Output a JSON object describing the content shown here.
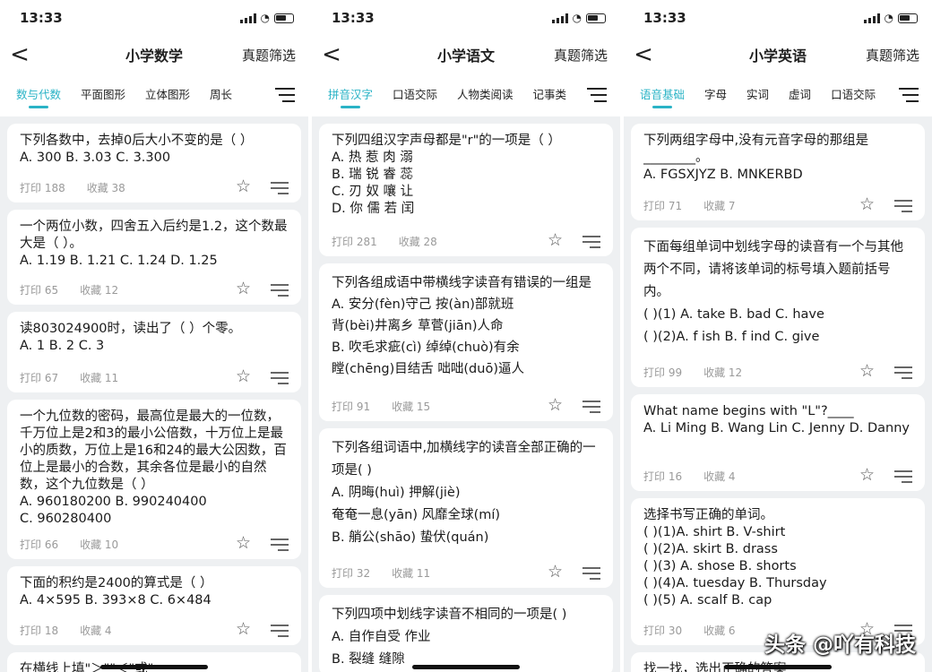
{
  "screens": [
    {
      "time": "13:33",
      "title": "小学数学",
      "filter": "真题筛选",
      "tabs": [
        "数与代数",
        "平面图形",
        "立体图形",
        "周长"
      ],
      "cards": [
        {
          "text": "下列各数中，去掉0后大小不变的是（  ）\nA.  300    B.  3.03    C.  3.300",
          "print": "打印 188",
          "fav": "收藏 38"
        },
        {
          "text": "一个两位小数，四舍五入后约是1.2，这个数最大是（  ）。\nA.  1.19    B.  1.21    C.  1.24    D.  1.25",
          "print": "打印 65",
          "fav": "收藏 12"
        },
        {
          "text": "读803024900时，读出了（  ）个零。\nA.  1    B.  2    C.  3",
          "print": "打印 67",
          "fav": "收藏 11"
        },
        {
          "text": "一个九位数的密码，最高位是最大的一位数，千万位上是2和3的最小公倍数，十万位上是最小的质数，万位上是16和24的最大公因数，百位上是最小的合数，其余各位是最小的自然数，这个九位数是（  ）\nA.   960180200       B.   990240400\nC.   960280400",
          "print": "打印 66",
          "fav": "收藏 10"
        },
        {
          "text": "下面的积约是2400的算式是（  ）\nA.  4×595    B.  393×8    C.  6×484",
          "print": "打印 18",
          "fav": "收藏 4"
        },
        {
          "text": "在横线上填\"＞\"\"＜\"或\"",
          "print": "",
          "fav": ""
        }
      ]
    },
    {
      "time": "13:33",
      "title": "小学语文",
      "filter": "真题筛选",
      "tabs": [
        "拼音汉字",
        "口语交际",
        "人物类阅读",
        "记事类"
      ],
      "cards": [
        {
          "text": "下列四组汉字声母都是\"r\"的一项是（  ）\nA. 热  惹  肉  溺\nB. 瑞  锐  睿  蕊\nC. 刃  奴  嚷  让\nD. 你  儒  若  闰",
          "print": "打印 281",
          "fav": "收藏 28"
        },
        {
          "text": "下列各组成语中带横线字读音有错误的一组是\nA. 安分(fèn)守己      按(àn)部就班\n     背(bèi)井离乡      草菅(jiān)人命\nB. 吹毛求疵(cì)        绰绰(chuò)有余\n     瞠(chēng)目结舌    咄咄(duō)逼人",
          "print": "打印 91",
          "fav": "收藏 15"
        },
        {
          "text": "下列各组词语中,加横线字的读音全部正确的一项是(   )\nA. 阴晦(huì)             押解(jiè)\n     奄奄一息(yān)      风靡全球(mí)\nB. 艄公(shāo)            蛰伏(quán)",
          "print": "打印 32",
          "fav": "收藏 11"
        },
        {
          "text": "下列四项中划线字读音不相同的一项是(   )\nA. 自作自受     作业\nB. 裂缝           缝隙",
          "print": "",
          "fav": ""
        }
      ]
    },
    {
      "time": "13:33",
      "title": "小学英语",
      "filter": "真题筛选",
      "tabs": [
        "语音基础",
        "字母",
        "实词",
        "虚词",
        "口语交际"
      ],
      "cards": [
        {
          "text": "下列两组字母中,没有元音字母的那组是________。\nA. FGSXJYZ          B. MNKERBD",
          "print": "打印 71",
          "fav": "收藏 7"
        },
        {
          "text": "下面每组单词中划线字母的读音有一个与其他两个不同，请将该单词的标号填入题前括号内。\n(     )(1) A. take         B. bad         C. have\n(     )(2)A. f ish          B. f ind        C. give",
          "print": "打印 99",
          "fav": "收藏 12"
        },
        {
          "text": "What name begins with \"L\"?____\nA. Li Ming   B. Wang Lin   C. Jenny   D. Danny",
          "print": "打印 16",
          "fav": "收藏 4"
        },
        {
          "text": "选择书写正确的单词。\n(  )(1)A. shirt    B. V-shirt\n(  )(2)A. skirt    B. drass\n(  )(3) A. shose    B. shorts\n(  )(4)A. tuesday   B. Thursday\n(  )(5) A. scalf     B. cap",
          "print": "打印 30",
          "fav": "收藏 6"
        },
        {
          "text": "找一找，选出正确的答案",
          "print": "",
          "fav": ""
        }
      ]
    }
  ],
  "watermark": "头条 @吖有科技",
  "colors": {
    "accent": "#2ab3c6",
    "background": "#eef0f2"
  }
}
